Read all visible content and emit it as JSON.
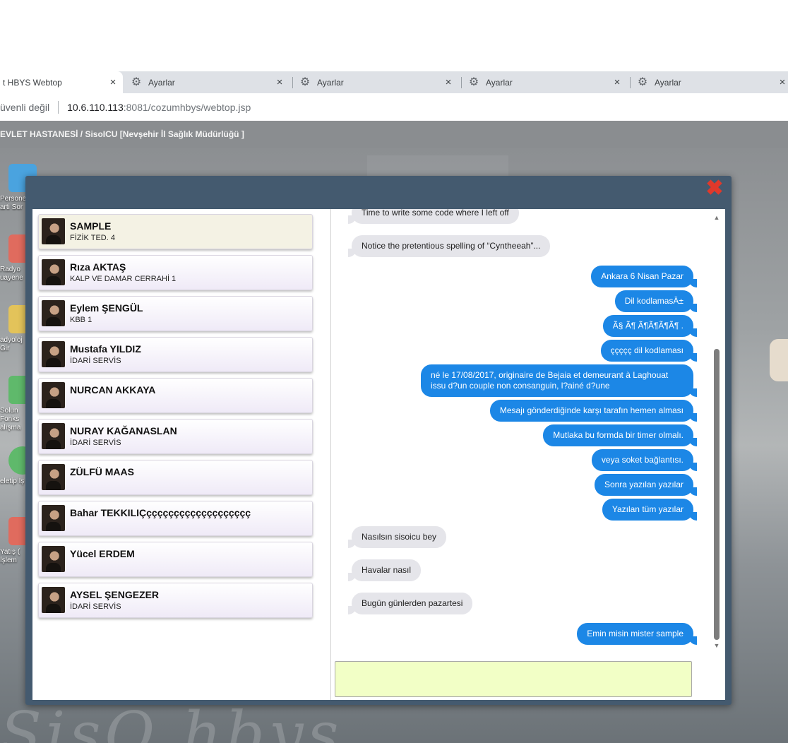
{
  "browser": {
    "tabs": [
      {
        "title": "t HBYS Webtop",
        "icon": "none",
        "active": true
      },
      {
        "title": "Ayarlar",
        "icon": "gear-icon",
        "active": false
      },
      {
        "title": "Ayarlar",
        "icon": "gear-icon",
        "active": false
      },
      {
        "title": "Ayarlar",
        "icon": "gear-icon",
        "active": false
      },
      {
        "title": "Ayarlar",
        "icon": "gear-icon",
        "active": false
      }
    ],
    "tab_close": "×",
    "security_text": "üvenli değil",
    "url_host": "10.6.110.113",
    "url_rest": ":8081/cozumhbys/webtop.jsp"
  },
  "app": {
    "header_title": "EVLET HASTANESİ / SisoICU [Nevşehir İl Sağlık Müdürlüğü ]"
  },
  "desktop": {
    "icons": [
      {
        "label": "Persone\narti Sor",
        "color": "#4aa3df"
      },
      {
        "label": "Radyo\nuayene",
        "color": "#e06b5e"
      },
      {
        "label": "adyoloj\nGir",
        "color": "#e3c35a"
      },
      {
        "label": "Solun\nFonks\nalışma",
        "color": "#5fb96b"
      },
      {
        "label": "eletip İş",
        "color": "#5fb96b"
      },
      {
        "label": "Yatış (\nİşlem",
        "color": "#e06b5e"
      }
    ],
    "watermark": "SisO hbys"
  },
  "modal": {
    "close_label": "✖",
    "contacts": [
      {
        "name": "SAMPLE",
        "dept": "FİZİK TED. 4",
        "selected": true
      },
      {
        "name": "Rıza AKTAŞ",
        "dept": "KALP VE DAMAR CERRAHİ 1",
        "selected": false
      },
      {
        "name": "Eylem ŞENGÜL",
        "dept": "KBB 1",
        "selected": false
      },
      {
        "name": "Mustafa YILDIZ",
        "dept": "İDARİ SERVİS",
        "selected": false
      },
      {
        "name": "NURCAN AKKAYA",
        "dept": "",
        "selected": false
      },
      {
        "name": "NURAY KAĞANASLAN",
        "dept": "İDARİ SERVİS",
        "selected": false
      },
      {
        "name": "ZÜLFÜ MAAS",
        "dept": "",
        "selected": false
      },
      {
        "name": "Bahar TEKKILIÇççççççççççççççççççç",
        "dept": "",
        "selected": false
      },
      {
        "name": "Yücel ERDEM",
        "dept": "",
        "selected": false
      },
      {
        "name": "AYSEL ŞENGEZER",
        "dept": "İDARİ SERVİS",
        "selected": false
      }
    ],
    "messages": [
      {
        "dir": "in",
        "text": "Time to write some code where I left off"
      },
      {
        "dir": "in",
        "text": "Notice the pretentious spelling of “Cyntheeah”..."
      },
      {
        "dir": "out",
        "text": "Ankara 6 Nisan Pazar"
      },
      {
        "dir": "out",
        "text": "Dil kodlamasÄ±"
      },
      {
        "dir": "out",
        "text": "Ã§ Ã¶ Ã¶Ã¶Ã¶Ã¶ ."
      },
      {
        "dir": "out",
        "text": "ççççç dil kodlaması"
      },
      {
        "dir": "out",
        "text": "né le 17/08/2017, originaire de Bejaia et demeurant à Laghouat issu d?un couple non consanguin, l?ainé d?une"
      },
      {
        "dir": "out",
        "text": "Mesajı gönderdiğinde karşı tarafın hemen alması"
      },
      {
        "dir": "out",
        "text": "Mutlaka bu formda bir timer olmalı."
      },
      {
        "dir": "out",
        "text": "veya soket bağlantısı."
      },
      {
        "dir": "out",
        "text": "Sonra yazılan yazılar"
      },
      {
        "dir": "out",
        "text": "Yazılan tüm yazılar"
      },
      {
        "dir": "in",
        "text": "Nasılsın sisoicu bey"
      },
      {
        "dir": "in",
        "text": "Havalar nasıl"
      },
      {
        "dir": "in",
        "text": "Bugün günlerden pazartesi"
      },
      {
        "dir": "out",
        "text": "Emin misin mister sample"
      }
    ],
    "composer_value": "",
    "scroll_up": "▲",
    "scroll_down": "▼"
  }
}
